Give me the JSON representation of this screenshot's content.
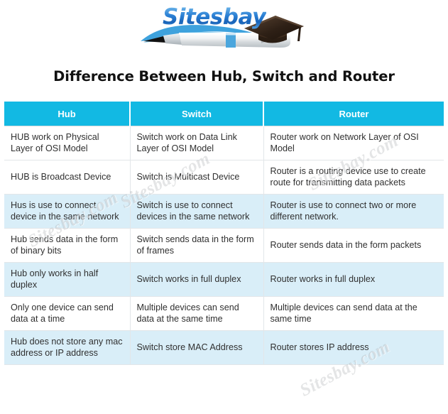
{
  "logo": {
    "brand": "Sitesbay",
    "icons": [
      "pen-icon",
      "graduation-cap-icon",
      "swoosh-icon"
    ]
  },
  "page_title": "Difference Between Hub, Switch and Router",
  "watermark_text": "Sitesbay.com",
  "colors": {
    "header_bg": "#12b9e3",
    "header_text": "#ffffff",
    "row_alt_bg": "#d9eef8",
    "row_bg": "#ffffff",
    "cell_text": "#303030",
    "title_text": "#111111",
    "brand_blue": "#1863b8"
  },
  "table": {
    "headers": [
      "Hub",
      "Switch",
      "Router"
    ],
    "rows": [
      [
        "HUB work on Physical Layer of OSI Model",
        "Switch work on Data Link Layer of OSI Model",
        "Router work on Network Layer of OSI Model"
      ],
      [
        "HUB is Broadcast Device",
        "Switch is Multicast Device",
        "Router is a routing device use to create route for transmitting data packets"
      ],
      [
        "Hus is use to connect device in the same network",
        "Switch is use to connect devices in the same network",
        "Router is use to connect two or more different network."
      ],
      [
        "Hub sends data in the form of binary bits",
        "Switch sends data in the form of frames",
        "Router sends data in the form packets"
      ],
      [
        "Hub only works in half duplex",
        "Switch works in full duplex",
        "Router works in full duplex"
      ],
      [
        "Only one device can send data at a time",
        "Multiple devices can send data at the same time",
        "Multiple devices can send data at the same time"
      ],
      [
        "Hub does not store any mac address or IP address",
        "Switch store MAC Address",
        "Router stores IP address"
      ]
    ]
  }
}
